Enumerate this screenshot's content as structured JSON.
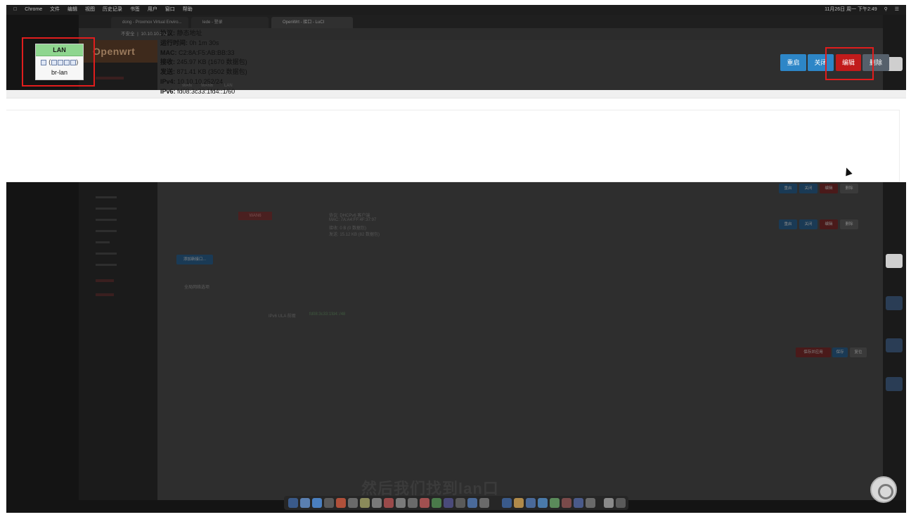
{
  "menubar": {
    "app": "Chrome",
    "menus": [
      "文件",
      "编辑",
      "视图",
      "历史记录",
      "书签",
      "用户",
      "窗口",
      "帮助"
    ],
    "clock": "11月26日 周一 下午2:49"
  },
  "browser": {
    "tabs": [
      "dong - Proxmox Virtual Enviro...",
      "lede - 登录",
      "OpenWrt - 接口 - LuCI"
    ],
    "url_host": "10.10.10.252",
    "url_prefix": "不安全"
  },
  "openwrt": {
    "logo": "Openwrt",
    "subtabs": [
      "WAN",
      "WAN6",
      "LAN"
    ],
    "dim_rows": [
      {
        "badge": "WAN6",
        "proto": "协议: DHCPv6 客户端",
        "mac": "MAC: 7A:A4:FF:4F:37:97",
        "rx": "接收: 0 B (0 数据包)",
        "tx": "发送: 15.12 KB (82 数据包)"
      }
    ],
    "add_interface": "添加新接口...",
    "global_section": "全局网络选项",
    "ula_label": "IPv6 ULA 前缀",
    "ula_value": "fd08:3c33:1fd4::/48",
    "save_apply": "保存并应用",
    "save": "保存",
    "reset": "复位"
  },
  "interface": {
    "badge": "LAN",
    "name": "br-lan",
    "ports_prefix": "(",
    "ports_suffix": ")",
    "proto_label": "协议:",
    "proto_value": "静态地址",
    "uptime_label": "运行时间:",
    "uptime_value": "0h 1m 30s",
    "mac_label": "MAC:",
    "mac_value": "C2:8A:F5:AB:BB:33",
    "rx_label": "接收:",
    "rx_value": "245.97 KB (1670 数据包)",
    "tx_label": "发送:",
    "tx_value": "871.41 KB (3502 数据包)",
    "ipv4_label": "IPv4:",
    "ipv4_value": "10.10.10.252/24",
    "ipv6_label": "IPv6:",
    "ipv6_value": "fd08:3c33:1fd4::1/60"
  },
  "actions": {
    "restart": "重启",
    "stop": "关闭",
    "edit": "编辑",
    "delete": "删除"
  },
  "subtitle": "然后我们找到lan口",
  "colors": {
    "lan_badge": "#8fd68f",
    "action_blue": "#2d86c7",
    "action_red": "#c11b1b",
    "action_gray": "#56606b",
    "highlight_box": "#e11d1d"
  }
}
